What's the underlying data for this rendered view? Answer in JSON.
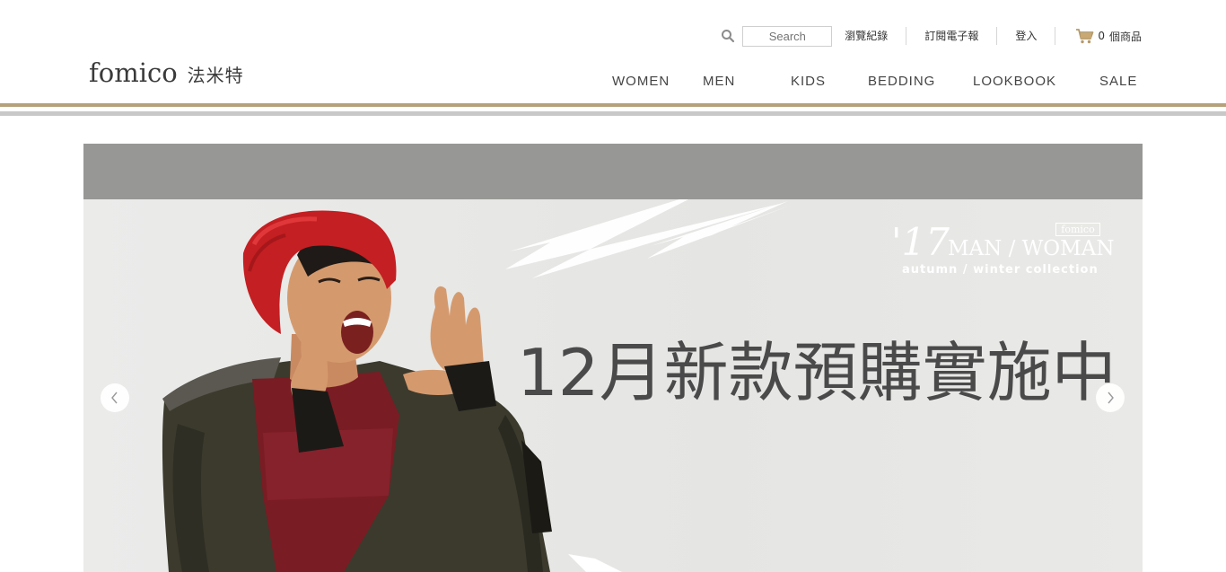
{
  "header": {
    "search": {
      "placeholder": "Search",
      "value": ""
    },
    "util_links": [
      "瀏覽紀錄",
      "訂閱電子報",
      "登入"
    ],
    "cart": {
      "count": "0",
      "label": "個商品"
    },
    "logo": {
      "en": "fomico",
      "zh": "法米特"
    },
    "nav": [
      "WOMEN",
      "MEN",
      "KIDS",
      "BEDDING",
      "LOOKBOOK",
      "SALE"
    ]
  },
  "hero": {
    "brand_stamp": "fomico",
    "year": "'17",
    "collection_title": "MAN / WOMAN",
    "collection_subtitle": "autumn / winter  collection",
    "headline": "12月新款預購實施中"
  },
  "colors": {
    "accent_gold": "#b5a17a",
    "divider_grey": "#c8c8c8",
    "hero_band": "#979795",
    "headline": "#4a4a4a"
  },
  "icons": {
    "search": "search-icon",
    "cart": "cart-icon",
    "prev": "chevron-left-icon",
    "next": "chevron-right-icon"
  }
}
